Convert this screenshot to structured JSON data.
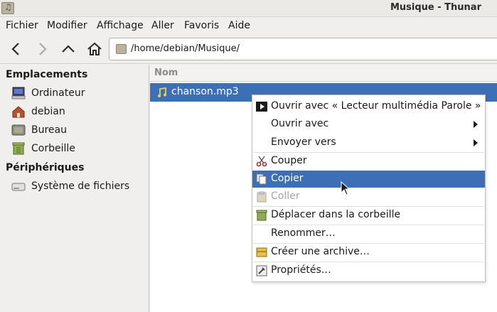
{
  "window": {
    "title": "Musique - Thunar"
  },
  "menubar": {
    "items": [
      "Fichier",
      "Modifier",
      "Affichage",
      "Aller",
      "Favoris",
      "Aide"
    ]
  },
  "toolbar": {
    "path": "/home/debian/Musique/"
  },
  "sidebar": {
    "sections": [
      {
        "heading": "Emplacements",
        "items": [
          "Ordinateur",
          "debian",
          "Bureau",
          "Corbeille"
        ]
      },
      {
        "heading": "Périphériques",
        "items": [
          "Système de fichiers"
        ]
      }
    ]
  },
  "fileview": {
    "column_header": "Nom",
    "files": [
      {
        "name": "chanson.mp3",
        "selected": true
      }
    ]
  },
  "context_menu": {
    "items": [
      {
        "label": "Ouvrir avec « Lecteur multimédia Parole »",
        "icon": "play-icon"
      },
      {
        "label": "Ouvrir avec",
        "submenu": true
      },
      {
        "label": "Envoyer vers",
        "submenu": true
      },
      {
        "label": "Couper",
        "icon": "scissors-icon"
      },
      {
        "label": "Copier",
        "icon": "copy-icon",
        "highlighted": true
      },
      {
        "label": "Coller",
        "icon": "paste-icon",
        "disabled": true
      },
      {
        "label": "Déplacer dans la corbeille",
        "icon": "trash-icon"
      },
      {
        "label": "Renommer…"
      },
      {
        "label": "Créer une archive…",
        "icon": "archive-icon"
      },
      {
        "label": "Propriétés…",
        "icon": "properties-icon"
      }
    ]
  },
  "colors": {
    "selection": "#3d6fb6",
    "disabled_text": "#a6a6a6"
  }
}
